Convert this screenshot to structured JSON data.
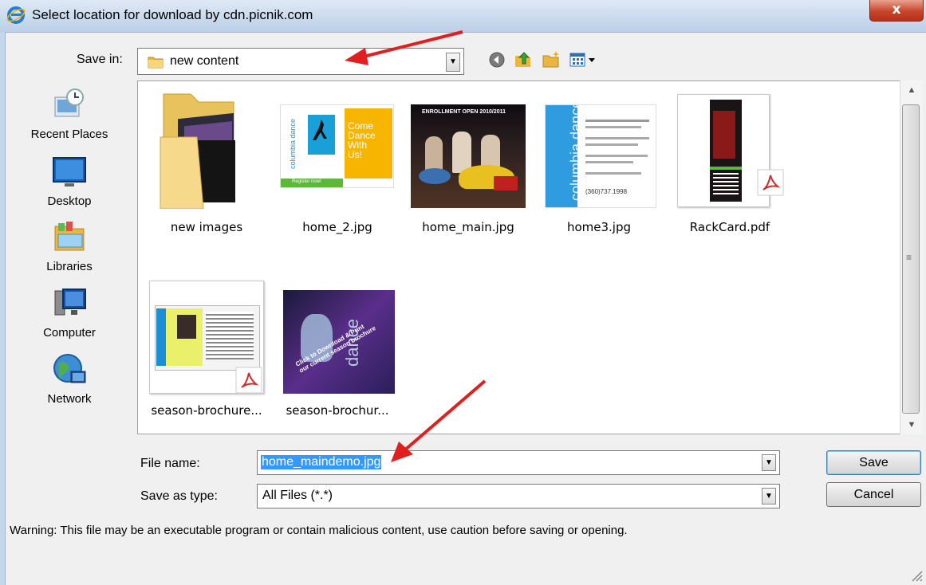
{
  "window": {
    "title": "Select location for download by cdn.picnik.com",
    "close_label": "x"
  },
  "save_in": {
    "label": "Save in:",
    "value": "new content"
  },
  "places": [
    {
      "label": "Recent Places",
      "icon": "recent-places-icon"
    },
    {
      "label": "Desktop",
      "icon": "desktop-icon"
    },
    {
      "label": "Libraries",
      "icon": "libraries-icon"
    },
    {
      "label": "Computer",
      "icon": "computer-icon"
    },
    {
      "label": "Network",
      "icon": "network-icon"
    }
  ],
  "files": [
    {
      "label": "new images",
      "kind": "folder"
    },
    {
      "label": "home_2.jpg",
      "kind": "image"
    },
    {
      "label": "home_main.jpg",
      "kind": "image"
    },
    {
      "label": "home3.jpg",
      "kind": "image"
    },
    {
      "label": "RackCard.pdf",
      "kind": "pdf"
    },
    {
      "label": "season-brochure...",
      "kind": "pdf"
    },
    {
      "label": "season-brochur...",
      "kind": "image"
    }
  ],
  "thumb_text": {
    "home2_line1": "Come",
    "home2_line2": "Dance",
    "home2_line3": "With",
    "home2_line4": "Us!",
    "home2_vertical": "columbia dance",
    "home2_register": "Register now!",
    "home_main_banner": "ENROLLMENT OPEN 2010/2011",
    "home3_vertical": "columbia dance",
    "home3_phone": "(360)737.1998",
    "brochure2_line1": "Click to Download & Print",
    "brochure2_line2": "our current season brochure"
  },
  "file_name": {
    "label": "File name:",
    "value": "home_maindemo.jpg"
  },
  "save_as_type": {
    "label": "Save as type:",
    "value": "All Files (*.*)"
  },
  "buttons": {
    "save": "Save",
    "cancel": "Cancel"
  },
  "warning": "Warning: This file may be an executable program or contain malicious content, use caution before saving or opening.",
  "colors": {
    "annotation_arrow": "#e02020",
    "selection": "#3399ff",
    "folder": "#f2c94c"
  }
}
